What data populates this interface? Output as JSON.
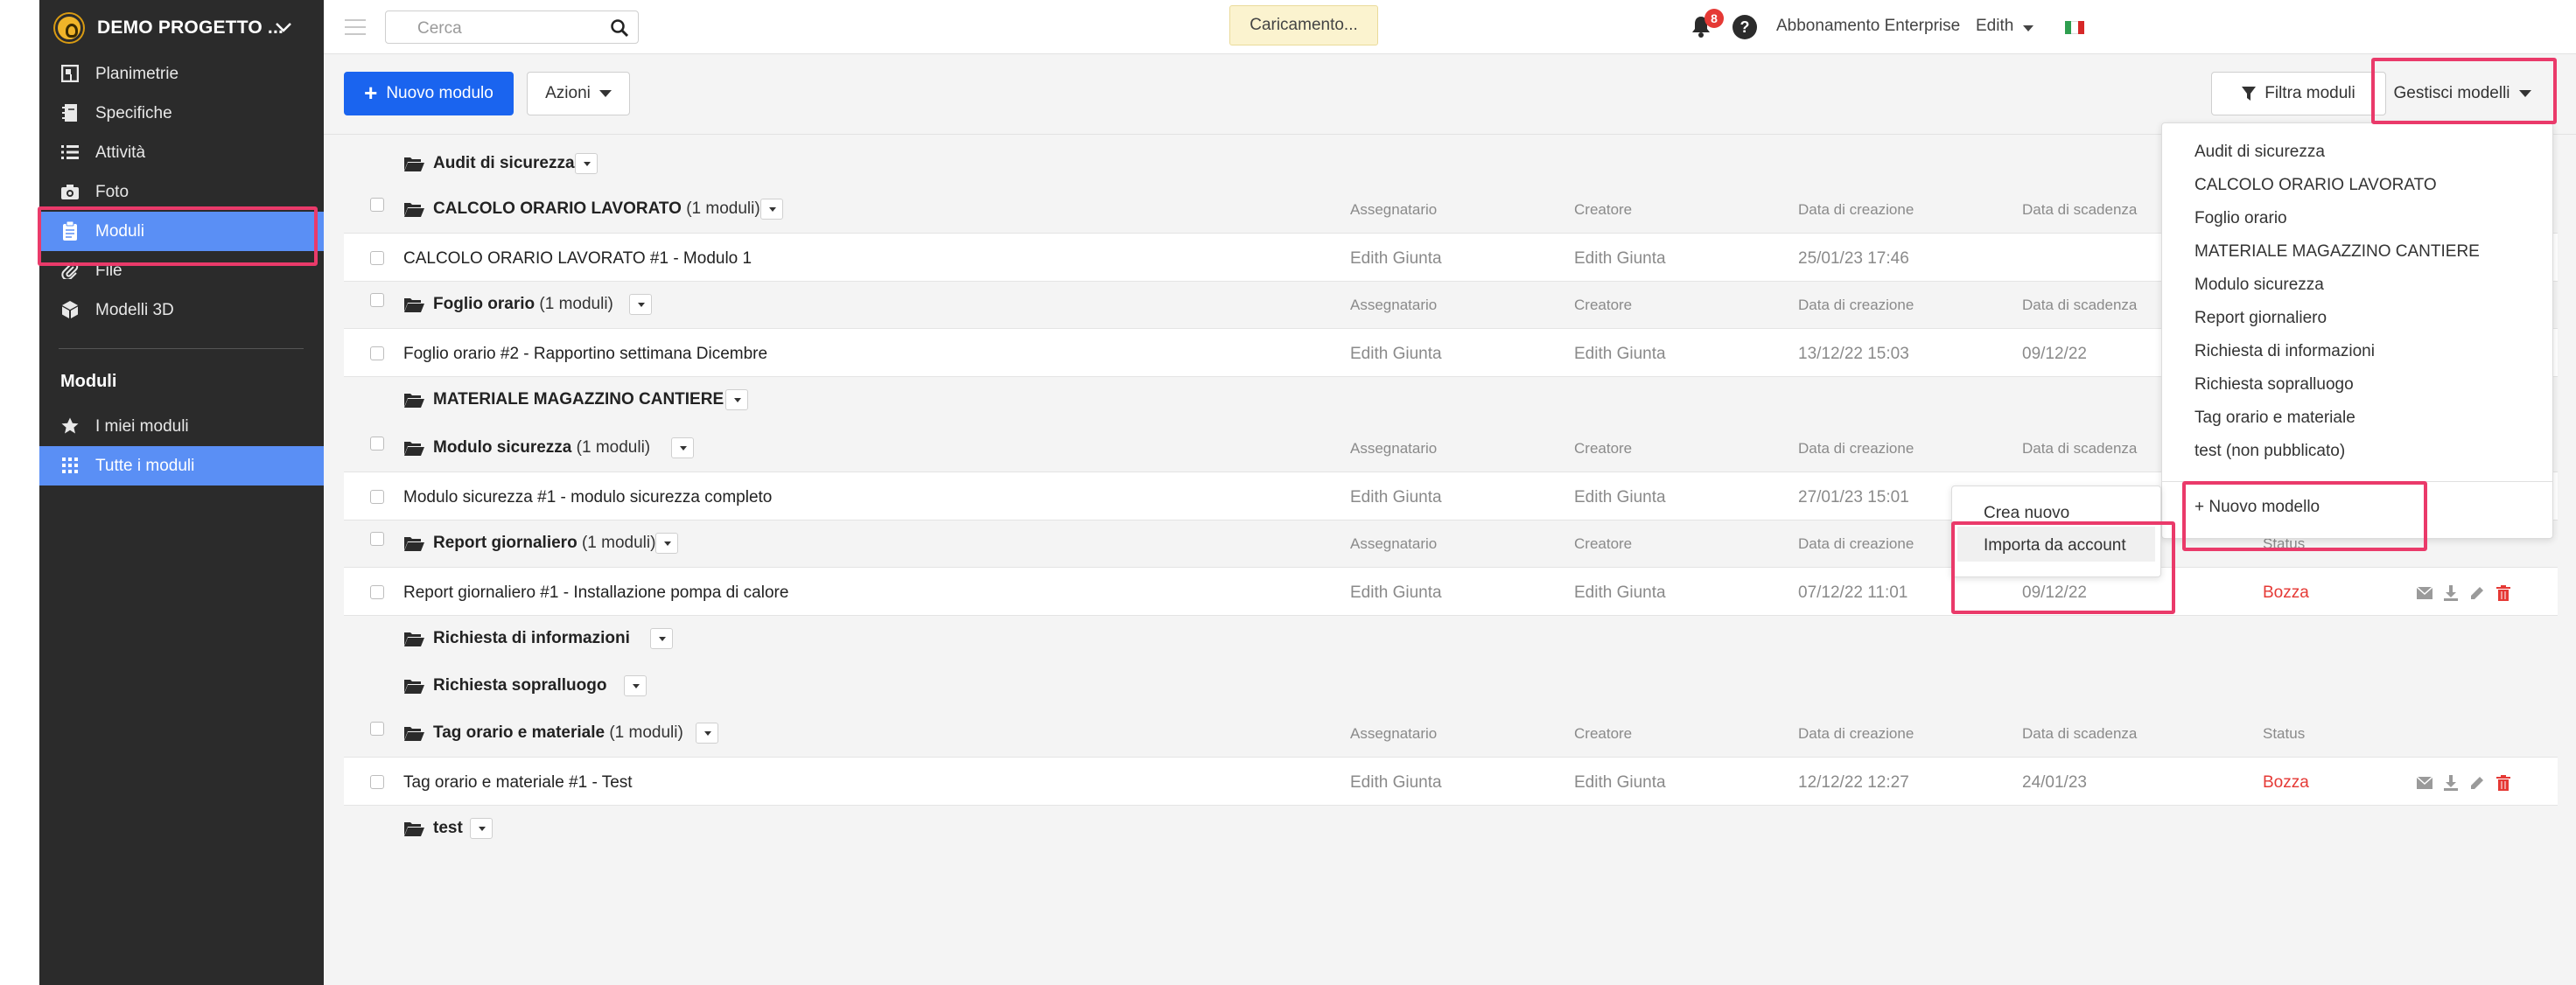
{
  "colors": {
    "sidebar_bg": "#2b2b2b",
    "active_blue": "#5a8ff5",
    "primary": "#1a64ef",
    "highlight_box": "#ea3a6a",
    "status_draft": "#e53935"
  },
  "sidebar": {
    "project_name": "DEMO PROGETTO ...",
    "items": [
      {
        "label": "Planimetrie",
        "icon": "floorplan-icon"
      },
      {
        "label": "Specifiche",
        "icon": "notebook-icon"
      },
      {
        "label": "Attività",
        "icon": "list-icon"
      },
      {
        "label": "Foto",
        "icon": "camera-icon"
      },
      {
        "label": "Moduli",
        "icon": "clipboard-icon"
      },
      {
        "label": "File",
        "icon": "paperclip-icon"
      },
      {
        "label": "Modelli 3D",
        "icon": "cube-icon"
      }
    ],
    "section_title": "Moduli",
    "section_items": [
      {
        "label": "I miei moduli",
        "icon": "star-icon"
      },
      {
        "label": "Tutte i moduli",
        "icon": "grid-icon"
      }
    ]
  },
  "topbar": {
    "search_placeholder": "Cerca",
    "loading": "Caricamento...",
    "notifications_count": "8",
    "help": "?",
    "plan": "Abbonamento Enterprise",
    "user": "Edith"
  },
  "toolbar": {
    "new_module": "Nuovo modulo",
    "actions": "Azioni",
    "filter": "Filtra moduli",
    "manage": "Gestisci modelli"
  },
  "columns": {
    "assignee": "Assegnatario",
    "creator": "Creatore",
    "created": "Data di creazione",
    "due": "Data di scadenza",
    "status": "Status"
  },
  "groups": {
    "g0": {
      "name": "Audit di sicurezza",
      "count": ""
    },
    "g1": {
      "name": "CALCOLO ORARIO LAVORATO",
      "count": "(1 moduli)"
    },
    "g2": {
      "name": "Foglio orario",
      "count": "(1 moduli)"
    },
    "g3": {
      "name": "MATERIALE MAGAZZINO CANTIERE",
      "count": ""
    },
    "g4": {
      "name": "Modulo sicurezza",
      "count": "(1 moduli)"
    },
    "g5": {
      "name": "Report giornaliero",
      "count": "(1 moduli)"
    },
    "g6": {
      "name": "Richiesta di informazioni",
      "count": ""
    },
    "g7": {
      "name": "Richiesta sopralluogo",
      "count": ""
    },
    "g8": {
      "name": "Tag orario e materiale",
      "count": "(1 moduli)"
    },
    "g9": {
      "name": "test",
      "count": ""
    }
  },
  "items": {
    "i1": {
      "title": "CALCOLO ORARIO LAVORATO #1 - Modulo 1",
      "assignee": "Edith Giunta",
      "creator": "Edith Giunta",
      "created": "25/01/23 17:46",
      "due": "",
      "status": ""
    },
    "i2": {
      "title": "Foglio orario #2 - Rapportino settimana Dicembre",
      "assignee": "Edith Giunta",
      "creator": "Edith Giunta",
      "created": "13/12/22 15:03",
      "due": "09/12/22",
      "status": ""
    },
    "i4": {
      "title": "Modulo sicurezza #1 - modulo sicurezza completo",
      "assignee": "Edith Giunta",
      "creator": "Edith Giunta",
      "created": "27/01/23 15:01",
      "due": "",
      "status": ""
    },
    "i5": {
      "title": "Report giornaliero #1 - Installazione pompa di calore",
      "assignee": "Edith Giunta",
      "creator": "Edith Giunta",
      "created": "07/12/22 11:01",
      "due": "09/12/22",
      "status": "Bozza"
    },
    "i8": {
      "title": "Tag orario e materiale #1 - Test",
      "assignee": "Edith Giunta",
      "creator": "Edith Giunta",
      "created": "12/12/22 12:27",
      "due": "24/01/23",
      "status": "Bozza"
    }
  },
  "manage_menu": {
    "items": [
      "Audit di sicurezza",
      "CALCOLO ORARIO LAVORATO",
      "Foglio orario",
      "MATERIALE MAGAZZINO CANTIERE",
      "Modulo sicurezza",
      "Report giornaliero",
      "Richiesta di informazioni",
      "Richiesta sopralluogo",
      "Tag orario e materiale",
      "test (non pubblicato)"
    ],
    "new_model": "+ Nuovo modello"
  },
  "new_model_submenu": {
    "create": "Crea nuovo",
    "import": "Importa da account"
  }
}
